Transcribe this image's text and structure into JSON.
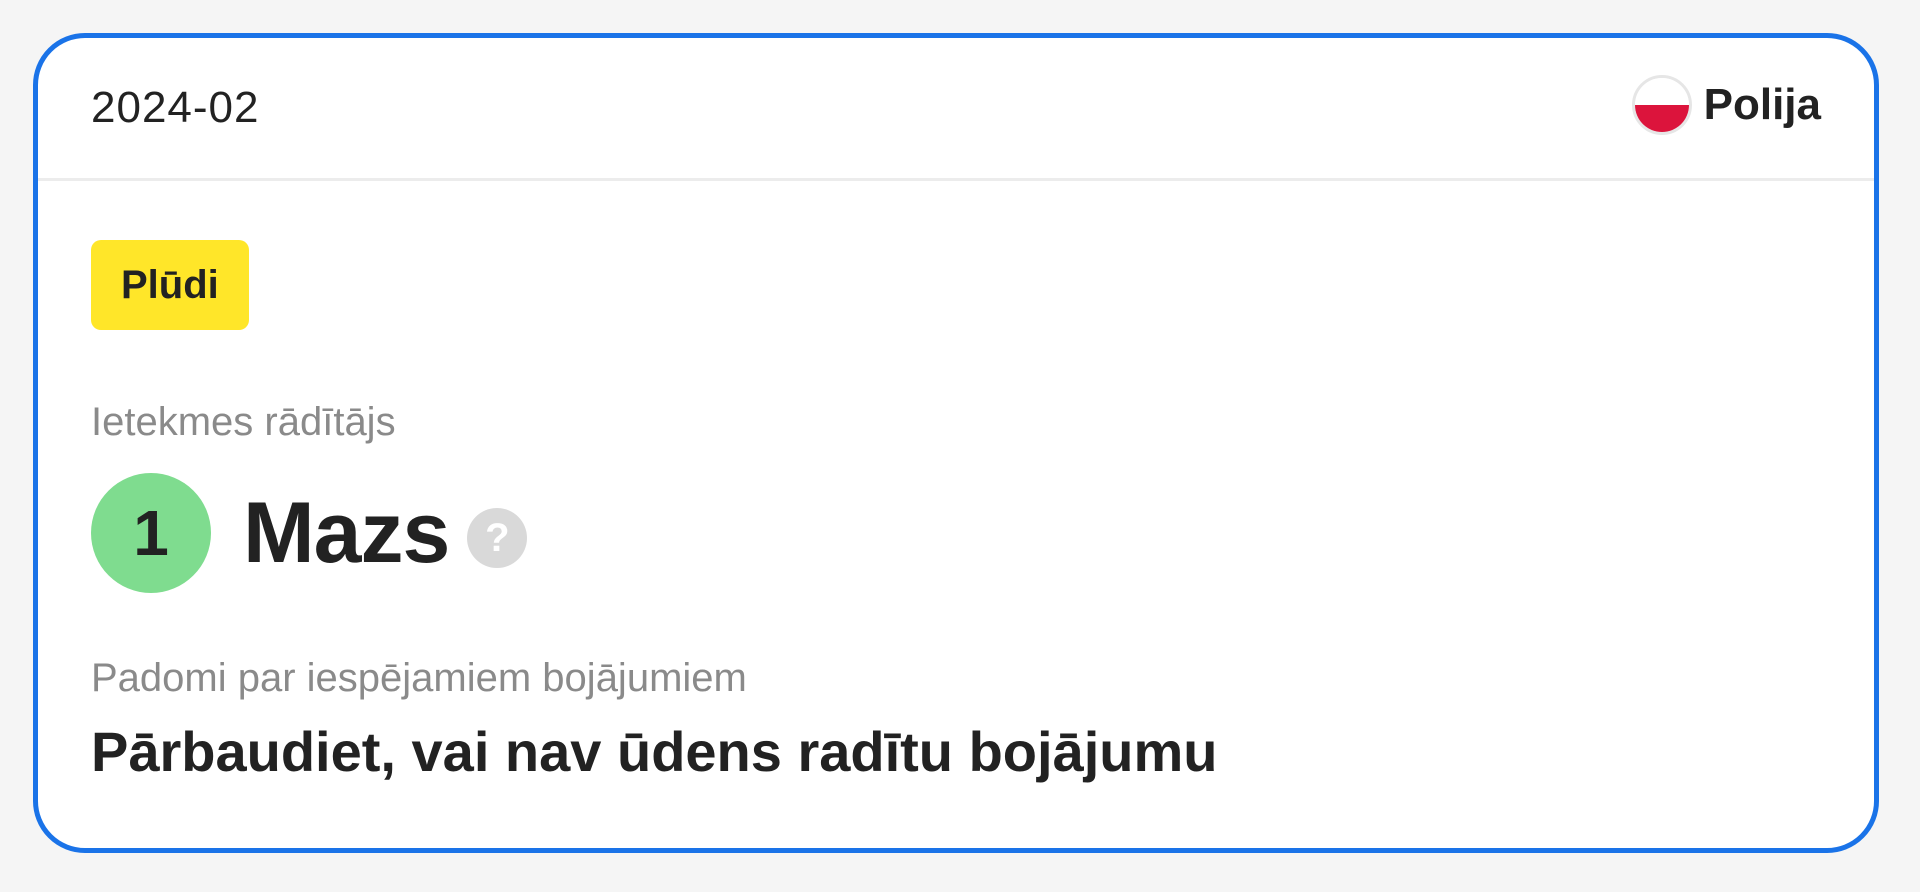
{
  "card": {
    "date": "2024-02",
    "country": {
      "name": "Polija",
      "flag_icon": "poland-flag-icon",
      "flag_colors": [
        "#ffffff",
        "#dc143c"
      ]
    },
    "event_type": {
      "label": "Plūdi",
      "color": "#ffe629"
    },
    "impact": {
      "label": "Ietekmes rādītājs",
      "level": "1",
      "value": "Mazs",
      "level_color": "#7fdc8f",
      "help_icon": "question-mark-icon",
      "help_glyph": "?"
    },
    "advice": {
      "label": "Padomi par iespējamiem bojājumiem",
      "text": "Pārbaudiet, vai nav ūdens radītu bojājumu"
    },
    "accent_color": "#1a73e8"
  }
}
